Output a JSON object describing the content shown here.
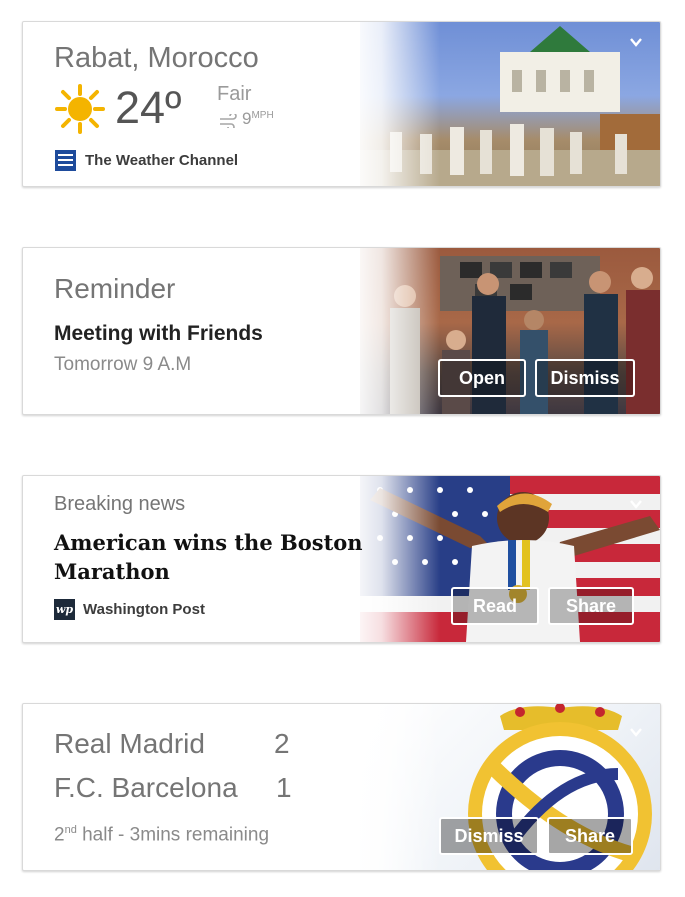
{
  "weather": {
    "location": "Rabat, Morocco",
    "temperature": "24º",
    "condition": "Fair",
    "wind_value": "9",
    "wind_unit": "MPH",
    "source": "The Weather Channel"
  },
  "reminder": {
    "label": "Reminder",
    "title": "Meeting with Friends",
    "time": "Tomorrow 9 A.M",
    "open_label": "Open",
    "dismiss_label": "Dismiss"
  },
  "news": {
    "label": "Breaking news",
    "headline_line1": "American wins the Boston",
    "headline_line2": "Marathon",
    "source": "Washington Post",
    "source_logo": "wp",
    "read_label": "Read",
    "share_label": "Share"
  },
  "score": {
    "team1": "Real Madrid",
    "score1": "2",
    "team2": "F.C. Barcelona",
    "score2": "1",
    "period_num": "2",
    "period_sup": "nd",
    "period_rest": " half - 3mins remaining",
    "dismiss_label": "Dismiss",
    "share_label": "Share"
  }
}
